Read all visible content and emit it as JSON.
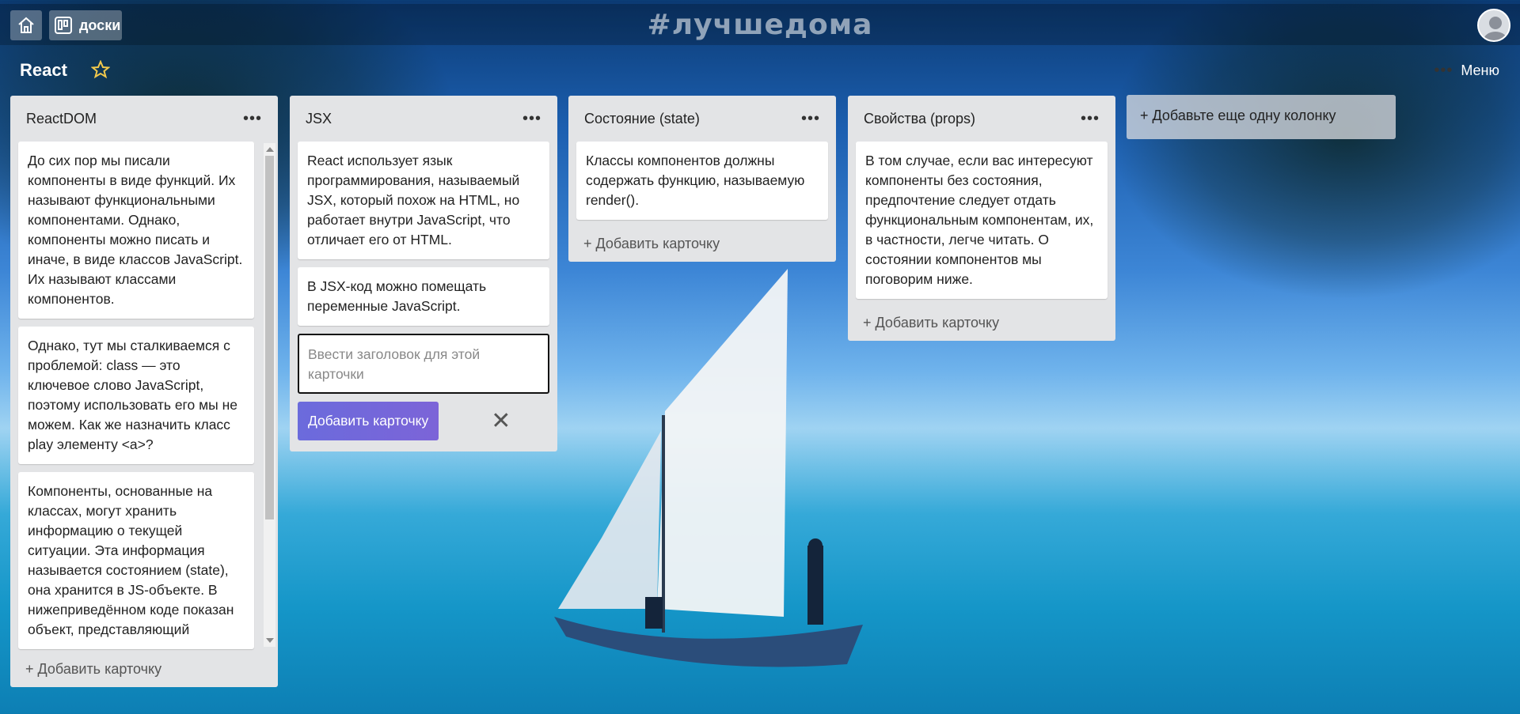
{
  "topbar": {
    "home_icon": "home-icon",
    "boards_label": "доски",
    "logo_text": "#лучшедома"
  },
  "board": {
    "title": "React",
    "menu_label": "Меню"
  },
  "columns": [
    {
      "title": "ReactDOM",
      "cards": [
        "До сих пор мы писали компоненты в виде функций. Их называют функциональными компонентами. Однако, компоненты можно писать и иначе, в виде классов JavaScript. Их называют классами компонентов.",
        "Однако, тут мы сталкиваемся с проблемой: class — это ключевое слово JavaScript, поэтому использовать его мы не можем. Как же назначить класс play элементу <a>?",
        "Компоненты, основанные на классах, могут хранить информацию о текущей ситуации. Эта информация называется состоянием (state), она хранится в JS-объекте. В нижеприведённом коде показан объект, представляющий"
      ],
      "add_label": "+ Добавить карточку"
    },
    {
      "title": "JSX",
      "cards": [
        "React использует язык программирования, называемый JSX, который похож на HTML, но работает внутри JavaScript, что отличает его от HTML.",
        "В JSX-код можно помещать переменные JavaScript."
      ],
      "input_placeholder": "Ввести заголовок для этой карточки",
      "add_button": "Добавить карточку",
      "close_glyph": "✕"
    },
    {
      "title": "Состояние (state)",
      "cards": [
        "Классы компонентов должны содержать функцию, называемую render()."
      ],
      "add_label": "+ Добавить карточку"
    },
    {
      "title": "Свойства (props)",
      "cards": [
        "В том случае, если вас интересуют компоненты без состояния, предпочтение следует отдать функциональным компонентам, их, в частности, легче читать. О состоянии компонентов мы поговорим ниже."
      ],
      "add_label": "+ Добавить карточку"
    }
  ],
  "add_column_label": "+ Добавьте еще одну колонку",
  "colors": {
    "accent_button": "#6b6bdc",
    "column_bg": "#e3e4e6",
    "star": "#f2c94c"
  }
}
